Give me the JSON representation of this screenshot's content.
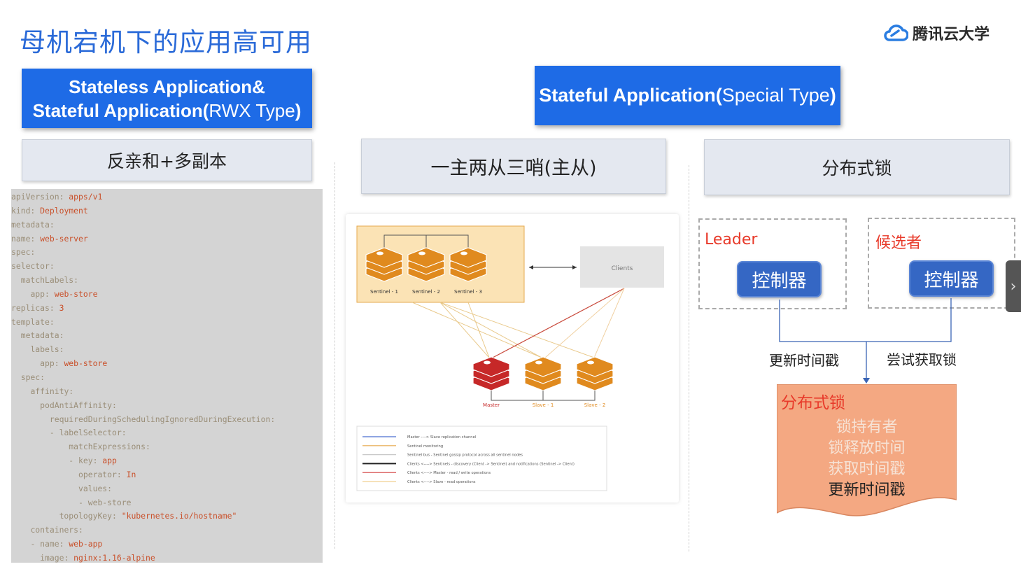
{
  "slide": {
    "title": "母机宕机下的应用高可用"
  },
  "brand": {
    "name": "腾讯云大学",
    "icon": "cloud-icon",
    "color": "#2a7de1"
  },
  "left_banner": {
    "line1": "Stateless Application&",
    "line2_bold": "Stateful Application(",
    "line2_light": "RWX Type",
    "line2_end": ")"
  },
  "right_banner": {
    "bold": "Stateful Application(",
    "light": "Special Type",
    "end": ")"
  },
  "columns": [
    {
      "title": "反亲和+多副本"
    },
    {
      "title": "一主两从三哨(主从)"
    },
    {
      "title": "分布式锁"
    }
  ],
  "yaml_lines": [
    [
      "",
      "apiVersion:",
      " apps/v1"
    ],
    [
      "",
      "kind:",
      " Deployment"
    ],
    [
      "",
      "metadata:",
      ""
    ],
    [
      "",
      "name:",
      " web-server"
    ],
    [
      "",
      "spec:",
      ""
    ],
    [
      "",
      "selector:",
      ""
    ],
    [
      "  ",
      "matchLabels:",
      ""
    ],
    [
      "    ",
      "app:",
      " web-store"
    ],
    [
      "",
      "replicas:",
      " 3"
    ],
    [
      "",
      "template:",
      ""
    ],
    [
      "  ",
      "metadata:",
      ""
    ],
    [
      "    ",
      "labels:",
      ""
    ],
    [
      "      ",
      "app:",
      " web-store"
    ],
    [
      "  ",
      "spec:",
      ""
    ],
    [
      "    ",
      "affinity:",
      ""
    ],
    [
      "      ",
      "podAntiAffinity:",
      ""
    ],
    [
      "        ",
      "requiredDuringSchedulingIgnoredDuringExecution:",
      ""
    ],
    [
      "        ",
      "- labelSelector:",
      ""
    ],
    [
      "            ",
      "matchExpressions:",
      ""
    ],
    [
      "            ",
      "- key:",
      " app"
    ],
    [
      "              ",
      "operator:",
      " In"
    ],
    [
      "              ",
      "values:",
      ""
    ],
    [
      "              ",
      "- web-store",
      ""
    ],
    [
      "          ",
      "topologyKey:",
      " \"kubernetes.io/hostname\""
    ],
    [
      "    ",
      "containers:",
      ""
    ],
    [
      "    ",
      "- name:",
      " web-app"
    ],
    [
      "      ",
      "image:",
      " nginx:1.16-alpine"
    ]
  ],
  "sentinel_diagram": {
    "sentinels": [
      "Sentinel - 1",
      "Sentinel - 2",
      "Sentinel - 3"
    ],
    "clients": "Clients",
    "nodes": [
      "Master",
      "Slave - 1",
      "Slave - 2"
    ],
    "legend": [
      "Master ----> Slave replication channel",
      "Sentinel monitoring",
      "Sentinel bus - Sentinel gossip protocol across all sentinel nodes",
      "Clients <----> Sentinels - discovery (Client -> Sentinel) and notifications (Sentinel -> Client)",
      "Clients <----> Master - read / write operations",
      "Clients <----> Slave - read operations"
    ],
    "colors": {
      "panel": "#fbe3b5",
      "master": "#c62828",
      "slave": "#e08a1e",
      "client_box": "#e4e4e4"
    }
  },
  "lock_demo": {
    "leader_label": "Leader",
    "candidate_label": "候选者",
    "controller_label": "控制器",
    "update_label": "更新时间戳",
    "try_label": "尝试获取锁",
    "lock_title": "分布式锁",
    "lock_items": [
      "锁持有者",
      "锁释放时间",
      "获取时间戳",
      "更新时间戳"
    ],
    "colors": {
      "accent": "#e83a2a",
      "button": "#3567c4",
      "note": "#f4a882"
    }
  },
  "side_tab": {
    "glyph": "›"
  }
}
